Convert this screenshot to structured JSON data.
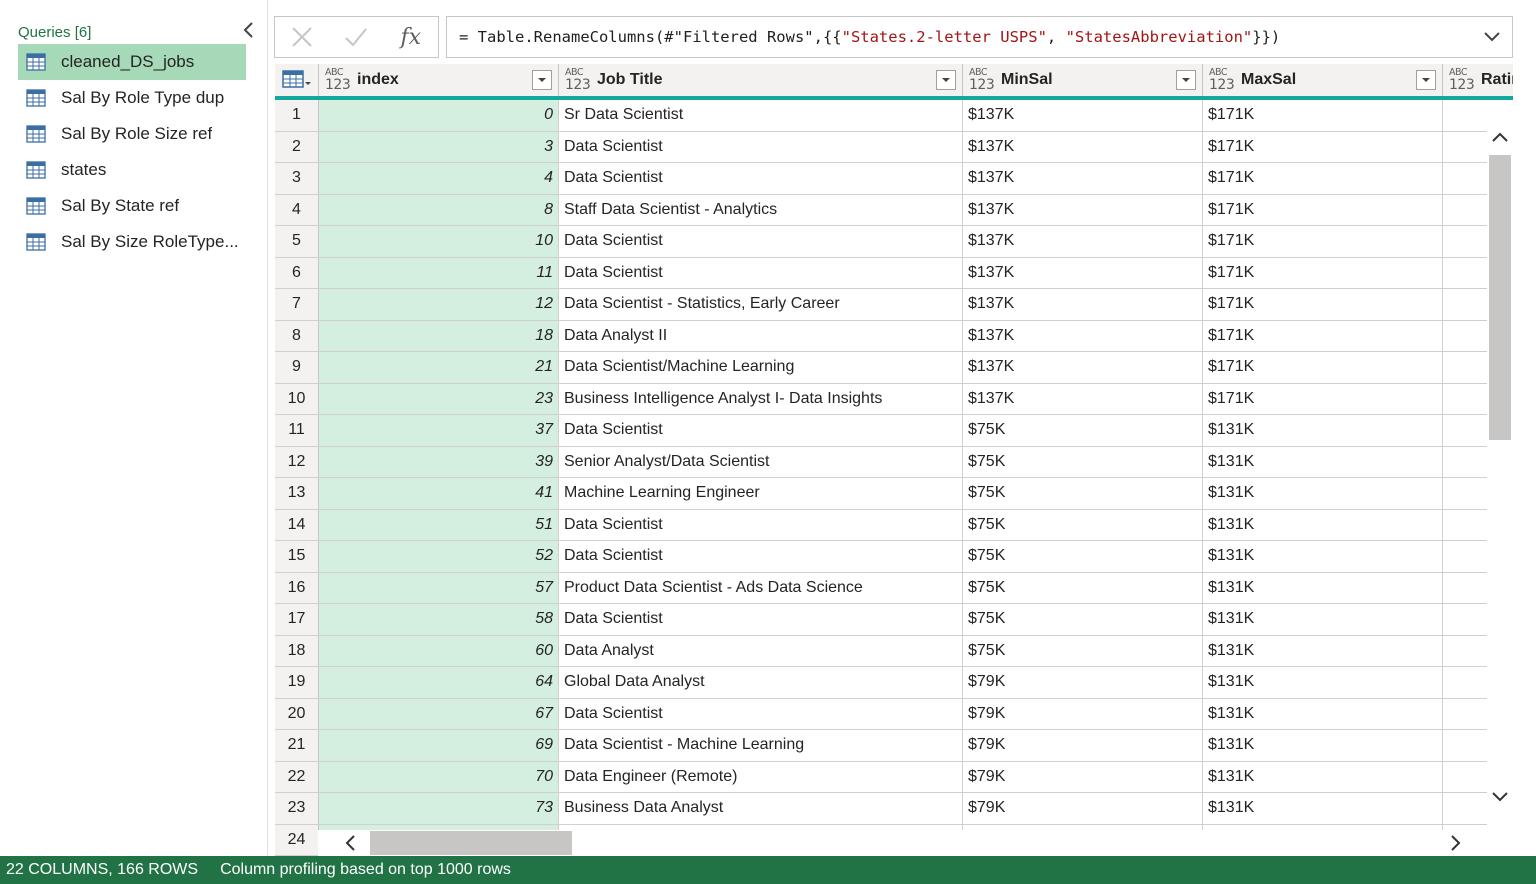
{
  "queries": {
    "header": "Queries [6]",
    "items": [
      {
        "label": "cleaned_DS_jobs",
        "selected": true
      },
      {
        "label": "Sal By Role Type dup",
        "selected": false
      },
      {
        "label": "Sal By Role Size ref",
        "selected": false
      },
      {
        "label": "states",
        "selected": false
      },
      {
        "label": "Sal By State ref",
        "selected": false
      },
      {
        "label": "Sal By Size RoleType...",
        "selected": false
      }
    ]
  },
  "formula_bar": {
    "cancel_icon": "x-icon",
    "commit_icon": "check-icon",
    "fx_label": "fx",
    "prefix": "= Table.RenameColumns(#\"Filtered Rows\",{{",
    "str1": "\"States.2-letter USPS\"",
    "sep": ", ",
    "str2": "\"StatesAbbreviation\"",
    "suffix": "}})"
  },
  "grid": {
    "type_icon_top": "ABC",
    "type_icon_bottom": "123",
    "columns": [
      {
        "name": "index"
      },
      {
        "name": "Job Title"
      },
      {
        "name": "MinSal"
      },
      {
        "name": "MaxSal"
      },
      {
        "name": "Ratin"
      }
    ],
    "rows": [
      {
        "n": "1",
        "index": "0",
        "title": "Sr Data Scientist",
        "min": "$137K",
        "max": "$171K"
      },
      {
        "n": "2",
        "index": "3",
        "title": "Data Scientist",
        "min": "$137K",
        "max": "$171K"
      },
      {
        "n": "3",
        "index": "4",
        "title": "Data Scientist",
        "min": "$137K",
        "max": "$171K"
      },
      {
        "n": "4",
        "index": "8",
        "title": "Staff Data Scientist - Analytics",
        "min": "$137K",
        "max": "$171K"
      },
      {
        "n": "5",
        "index": "10",
        "title": "Data Scientist",
        "min": "$137K",
        "max": "$171K"
      },
      {
        "n": "6",
        "index": "11",
        "title": "Data Scientist",
        "min": "$137K",
        "max": "$171K"
      },
      {
        "n": "7",
        "index": "12",
        "title": "Data Scientist - Statistics, Early Career",
        "min": "$137K",
        "max": "$171K"
      },
      {
        "n": "8",
        "index": "18",
        "title": "Data Analyst II",
        "min": "$137K",
        "max": "$171K"
      },
      {
        "n": "9",
        "index": "21",
        "title": "Data Scientist/Machine Learning",
        "min": "$137K",
        "max": "$171K"
      },
      {
        "n": "10",
        "index": "23",
        "title": "Business Intelligence Analyst I- Data Insights",
        "min": "$137K",
        "max": "$171K"
      },
      {
        "n": "11",
        "index": "37",
        "title": "Data Scientist",
        "min": "$75K",
        "max": "$131K"
      },
      {
        "n": "12",
        "index": "39",
        "title": "Senior Analyst/Data Scientist",
        "min": "$75K",
        "max": "$131K"
      },
      {
        "n": "13",
        "index": "41",
        "title": "Machine Learning Engineer",
        "min": "$75K",
        "max": "$131K"
      },
      {
        "n": "14",
        "index": "51",
        "title": "Data Scientist",
        "min": "$75K",
        "max": "$131K"
      },
      {
        "n": "15",
        "index": "52",
        "title": "Data Scientist",
        "min": "$75K",
        "max": "$131K"
      },
      {
        "n": "16",
        "index": "57",
        "title": "Product Data Scientist - Ads Data Science",
        "min": "$75K",
        "max": "$131K"
      },
      {
        "n": "17",
        "index": "58",
        "title": "Data Scientist",
        "min": "$75K",
        "max": "$131K"
      },
      {
        "n": "18",
        "index": "60",
        "title": "Data Analyst",
        "min": "$75K",
        "max": "$131K"
      },
      {
        "n": "19",
        "index": "64",
        "title": "Global Data Analyst",
        "min": "$79K",
        "max": "$131K"
      },
      {
        "n": "20",
        "index": "67",
        "title": "Data Scientist",
        "min": "$79K",
        "max": "$131K"
      },
      {
        "n": "21",
        "index": "69",
        "title": "Data Scientist - Machine Learning",
        "min": "$79K",
        "max": "$131K"
      },
      {
        "n": "22",
        "index": "70",
        "title": "Data Engineer (Remote)",
        "min": "$79K",
        "max": "$131K"
      },
      {
        "n": "23",
        "index": "73",
        "title": "Business Data Analyst",
        "min": "$79K",
        "max": "$131K"
      },
      {
        "n": "24",
        "index": "",
        "title": "",
        "min": "",
        "max": ""
      }
    ]
  },
  "status_bar": {
    "columns_rows": "22 COLUMNS, 166 ROWS",
    "profiling": "Column profiling based on top 1000 rows"
  },
  "colors": {
    "accent_green": "#217346",
    "selected_query": "#a6d9b8",
    "selected_column": "#d4efe0",
    "header_underline": "#13a89e",
    "string_literal": "#a31515"
  }
}
